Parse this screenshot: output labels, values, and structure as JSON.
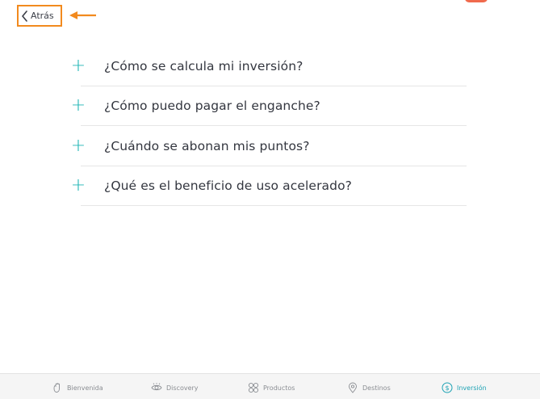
{
  "header": {
    "back_label": "Atrás"
  },
  "faq": {
    "items": [
      {
        "icon": "plus-icon",
        "question": "¿Cómo se calcula mi inversión?"
      },
      {
        "icon": "plus-icon",
        "question": "¿Cómo puedo pagar el enganche?"
      },
      {
        "icon": "plus-icon",
        "question": "¿Cuándo se abonan mis puntos?"
      },
      {
        "icon": "plus-icon",
        "question": "¿Qué es el beneficio de uso acelerado?"
      }
    ]
  },
  "tabs": [
    {
      "label": "Bienvenida",
      "icon": "hand-icon",
      "active": false
    },
    {
      "label": "Discovery",
      "icon": "eye-icon",
      "active": false
    },
    {
      "label": "Productos",
      "icon": "grid-icon",
      "active": false
    },
    {
      "label": "Destinos",
      "icon": "map-pin-icon",
      "active": false
    },
    {
      "label": "Inversión",
      "icon": "dollar-icon",
      "active": true
    }
  ],
  "colors": {
    "accent": "#1fb5b5",
    "active_tab": "#1fa3b5",
    "annotation": "#f28a1e",
    "text": "#33363f"
  }
}
